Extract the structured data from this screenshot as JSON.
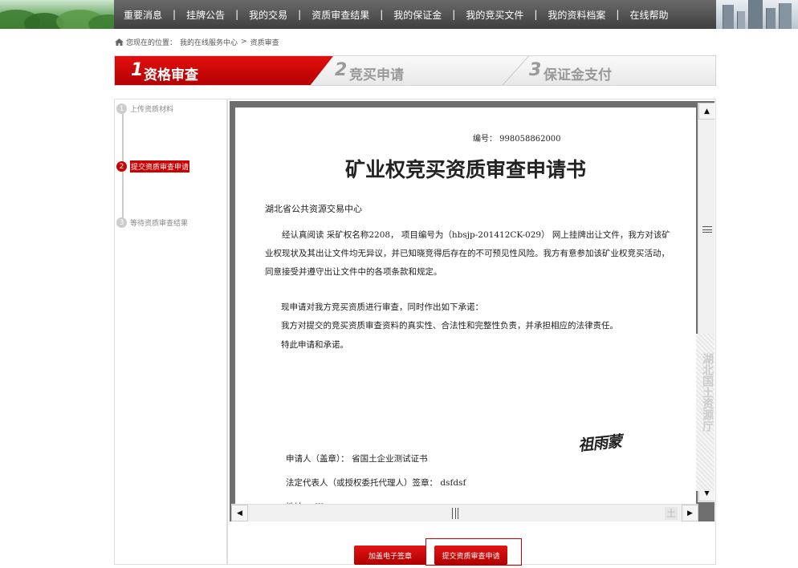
{
  "nav": {
    "items": [
      "重要消息",
      "挂牌公告",
      "我的交易",
      "资质审查结果",
      "我的保证金",
      "我的竞买文件",
      "我的资料档案",
      "在线帮助"
    ],
    "separator": "|"
  },
  "breadcrumb": {
    "prefix": "您现在的位置：",
    "items": [
      "我的在线服务中心",
      "资质审查"
    ],
    "separator": ">"
  },
  "steps": [
    {
      "num": "1",
      "label": "资格审查",
      "active": true
    },
    {
      "num": "2",
      "label": "竞买申请",
      "active": false
    },
    {
      "num": "3",
      "label": "保证金支付",
      "active": false
    }
  ],
  "sub_steps": [
    {
      "num": "1",
      "label": "上传资质材料",
      "active": false
    },
    {
      "num": "2",
      "label": "提交资质审查申请",
      "active": true
    },
    {
      "num": "3",
      "label": "等待资质审查结果",
      "active": false
    }
  ],
  "document": {
    "number_line": "编号： 998058862000",
    "title": "矿业权竞买资质审查申请书",
    "addressee": "湖北省公共资源交易中心",
    "para1": "经认真阅读 采矿权名称2208， 项目编号为（hbsjp-201412CK-029） 网上挂牌出让文件，我方对该矿业权现状及其出让文件均无异议，并已知晓竞得后存在的不可预见性风险。我方有意参加该矿业权竞买活动，同意接受并遵守出让文件中的各项条款和规定。",
    "line1": "现申请对我方竞买资质进行审查，同时作出如下承诺：",
    "line2": "我方对提交的竞买资质审查资料的真实性、合法性和完整性负责，并承担相应的法律责任。",
    "line3": "特此申请和承诺。",
    "signature": "祖雨蒙",
    "applicant": "申请人（盖章）：  省国土企业测试证书",
    "legal_rep": "法定代表人（或授权委托代理人）签章：  dsfdsf",
    "address_partial": "地址：   fff"
  },
  "watermark": "湖北国土资源厅",
  "buttons": {
    "add_seal": "加盖电子签章",
    "submit": "提交资质审查申请"
  },
  "colors": {
    "accent": "#c00000",
    "nav_bg": "#4a4a4a"
  }
}
